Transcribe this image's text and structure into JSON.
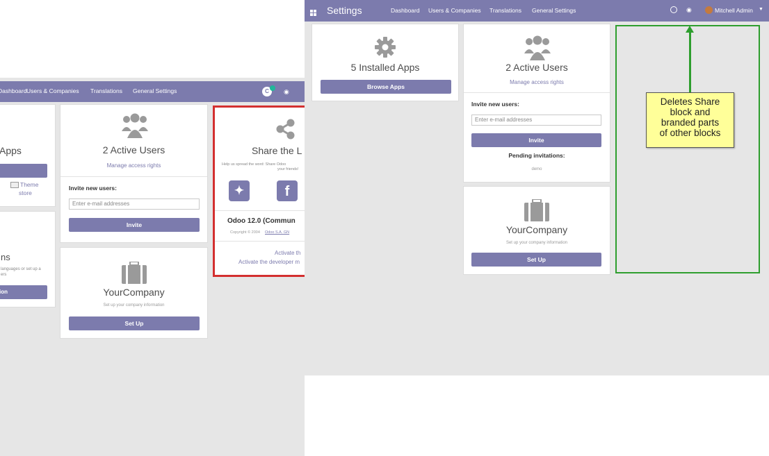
{
  "back": {
    "nav": [
      "Dashboard",
      "Users & Companies",
      "Translations",
      "General Settings"
    ],
    "apps": {
      "title": "Installed Apps",
      "title_visible": "Apps",
      "button": "Browse Apps",
      "theme_store": [
        "Theme",
        "store"
      ]
    },
    "translations": {
      "title_visible": "ns",
      "desc_visible": [
        "languages or set up a",
        "ers"
      ],
      "button_visible": "ion"
    },
    "users": {
      "title": "2 Active Users",
      "link": "Manage access rights",
      "invite_label": "Invite new users:",
      "invite_placeholder": "Enter e-mail addresses",
      "invite_button": "Invite"
    },
    "company": {
      "title": "YourCompany",
      "desc": "Set up your company information",
      "button": "Set Up"
    },
    "share": {
      "title_visible": "Share the L",
      "desc_visible": [
        "Help us spread the word: Share Odoo",
        "your friends!"
      ],
      "version_visible": "Odoo 12.0 (Commun",
      "copyright_visible": "Copyright © 2004 ",
      "copyright_link_visible": "Odoo S.A. GN",
      "dev1_visible": "Activate th",
      "dev2_visible": "Activate the developer m"
    },
    "highlight_color": "#d32f2f"
  },
  "front": {
    "app_title": "Settings",
    "nav": [
      "Dashboard",
      "Users & Companies",
      "Translations",
      "General Settings"
    ],
    "user": "Mitchell Admin",
    "apps": {
      "title": "5 Installed Apps",
      "button": "Browse Apps"
    },
    "users": {
      "title": "2 Active Users",
      "link": "Manage access rights",
      "invite_label": "Invite new users:",
      "invite_placeholder": "Enter e-mail addresses",
      "invite_button": "Invite",
      "pending_label": "Pending invitations:",
      "pending_value": "demo"
    },
    "company": {
      "title": "YourCompany",
      "desc": "Set up your company information",
      "button": "Set Up"
    }
  },
  "annotation": {
    "lines": [
      "Deletes Share",
      "block and",
      "branded parts",
      "of other blocks"
    ],
    "color": "#2e9e2e"
  }
}
